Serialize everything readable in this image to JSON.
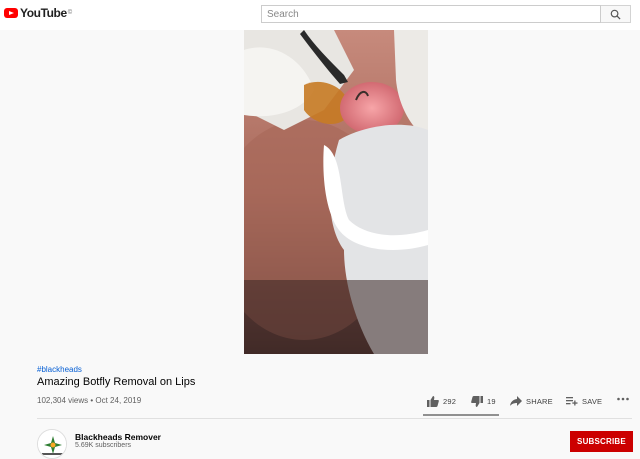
{
  "header": {
    "logo_text": "YouTube",
    "logo_sup": "©",
    "search_placeholder": "Search"
  },
  "video": {
    "hashtag": "#blackheads",
    "title": "Amazing Botfly Removal on Lips",
    "meta": "102,304 views • Oct 24, 2019",
    "likes": "292",
    "dislikes": "19",
    "share_label": "SHARE",
    "save_label": "SAVE",
    "like_ratio": 0.94
  },
  "channel": {
    "name": "Blackheads Remover",
    "subscribers": "5.69K subscribers",
    "subscribe_label": "SUBSCRIBE"
  },
  "colors": {
    "brand": "#ff0000",
    "subscribe": "#cc0000",
    "hashtag": "#065fd4"
  }
}
